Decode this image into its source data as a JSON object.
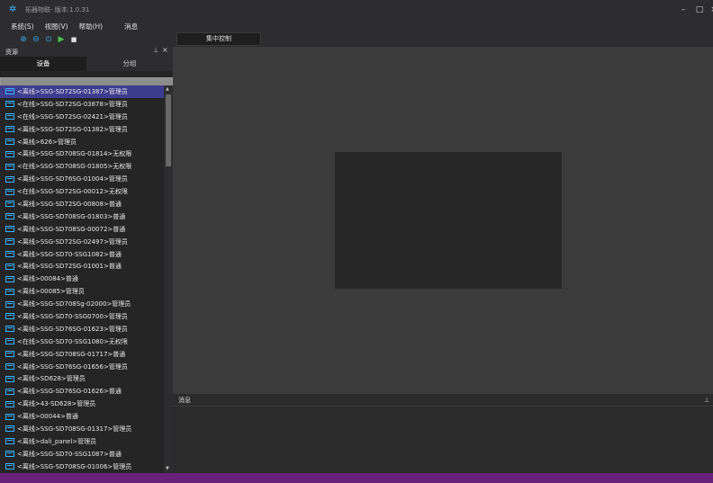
{
  "window": {
    "title": "拓器物联- 版本:1.0.31",
    "logo_icon": "app-logo-icon",
    "minimize": "–",
    "maximize": "□",
    "close": "×"
  },
  "menu": [
    "系统(S)",
    "视图(V)",
    "帮助(H)",
    "消息"
  ],
  "toolbar": [
    {
      "name": "zoom-in-icon",
      "glyph": "⊕"
    },
    {
      "name": "zoom-out-icon",
      "glyph": "⊖"
    },
    {
      "name": "zoom-reset-icon",
      "glyph": "⊙"
    },
    {
      "name": "play-icon",
      "glyph": "▶"
    },
    {
      "name": "stop-icon",
      "glyph": "■"
    }
  ],
  "left_panel": {
    "title": "资源",
    "pin": "ꟷ",
    "close": "×",
    "tabs": [
      "设备",
      "分组"
    ],
    "search_value": ""
  },
  "devices": [
    "<离线>SSG-SD72SG-01387>管理员",
    "<在线>SSG-SD72SG-03878>管理员",
    "<在线>SSG-SD72SG-02421>管理员",
    "<离线>SSG-SD72SG-01382>管理员",
    "<离线>626>管理员",
    "<离线>SSG-SD708SG-01814>无权限",
    "<在线>SSG-SD708SG-01805>无权限",
    "<离线>SSG-SD76SG-01004>管理员",
    "<在线>SSG-SD72SG-00012>无权限",
    "<离线>SSG-SD72SG-00808>普通",
    "<离线>SSG-SD708SG-01803>普通",
    "<离线>SSG-SD708SG-00072>普通",
    "<离线>SSG-SD72SG-02497>管理员",
    "<离线>SSG-SD70-SSG1082>普通",
    "<离线>SSG-SD72SG-01001>普通",
    "<离线>00084>普通",
    "<离线>00085>管理员",
    "<离线>SSG-SD708Sg-02000>管理员",
    "<离线>SSG-SD70-SSG0700>管理员",
    "<离线>SSG-SD76SG-01623>管理员",
    "<在线>SSG-SD70-SSG1080>无权限",
    "<离线>SSG-SD708SG-01717>普通",
    "<离线>SSG-SD76SG-01656>管理员",
    "<离线>SD628>管理员",
    "<离线>SSG-SD76SG-01626>普通",
    "<离线>43-SD628>管理员",
    "<离线>00044>普通",
    "<离线>SSG-SD708SG-01317>管理员",
    "<离线>dali_panel>管理员",
    "<离线>SSG-SD70-SSG1087>普通",
    "<离线>SSG-SD708SG-01006>管理员"
  ],
  "selected_index": 0,
  "document_tab": "集中控制",
  "messages": {
    "title": "消息",
    "pin": "ꟷ"
  },
  "colors": {
    "accent": "#68217a",
    "selection": "#3d3d8f",
    "icon": "#35b3ff"
  }
}
